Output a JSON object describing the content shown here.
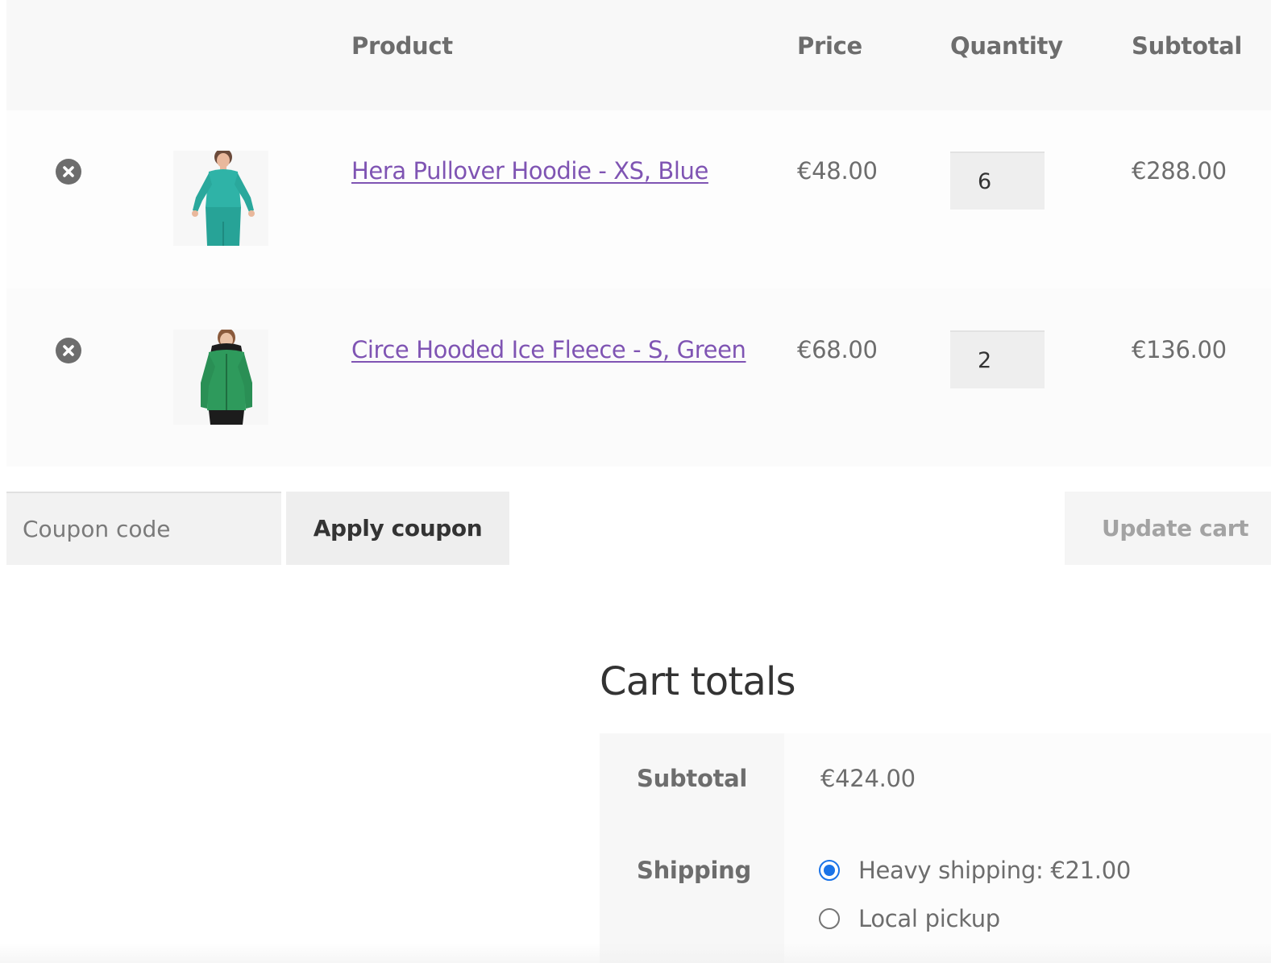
{
  "table": {
    "headers": {
      "product": "Product",
      "price": "Price",
      "quantity": "Quantity",
      "subtotal": "Subtotal"
    },
    "items": [
      {
        "name": "Hera Pullover Hoodie - XS, Blue",
        "price": "€48.00",
        "quantity": "6",
        "subtotal": "€288.00",
        "thumb_color": "#2fb3a7"
      },
      {
        "name": "Circe Hooded Ice Fleece - S, Green",
        "price": "€68.00",
        "quantity": "2",
        "subtotal": "€136.00",
        "thumb_color": "#2e9a5c"
      }
    ]
  },
  "actions": {
    "coupon_placeholder": "Coupon code",
    "apply_label": "Apply coupon",
    "update_label": "Update cart"
  },
  "totals": {
    "title": "Cart totals",
    "subtotal_label": "Subtotal",
    "subtotal_value": "€424.00",
    "shipping_label": "Shipping",
    "shipping_options": [
      {
        "label": "Heavy shipping: €21.00",
        "selected": true
      },
      {
        "label": "Local pickup",
        "selected": false
      }
    ]
  },
  "colors": {
    "link": "#7f54b3",
    "radio_accent": "#1a73e8"
  }
}
